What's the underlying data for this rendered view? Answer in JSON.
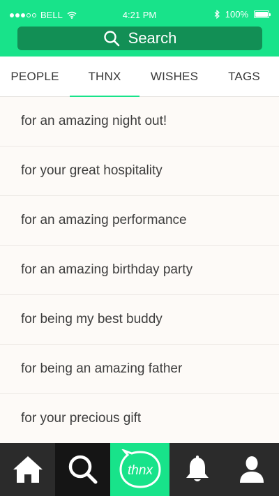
{
  "status_bar": {
    "carrier": "BELL",
    "time": "4:21 PM",
    "battery": "100%",
    "signal_dots_filled": 3,
    "signal_dots_total": 5
  },
  "search": {
    "label": "Search",
    "icon": "search-icon"
  },
  "tabs": [
    {
      "label": "PEOPLE",
      "active": false
    },
    {
      "label": "THNX",
      "active": true
    },
    {
      "label": "WISHES",
      "active": false
    },
    {
      "label": "TAGS",
      "active": false
    }
  ],
  "thnx_list": [
    {
      "text": "for an amazing night out!"
    },
    {
      "text": "for your great hospitality"
    },
    {
      "text": "for an amazing performance"
    },
    {
      "text": "for an amazing birthday party"
    },
    {
      "text": "for being my best buddy"
    },
    {
      "text": "for being an amazing father"
    },
    {
      "text": "for your precious gift"
    }
  ],
  "bottom_nav": [
    {
      "icon": "home-icon"
    },
    {
      "icon": "search-icon"
    },
    {
      "icon": "thnx-logo",
      "brand_text": "thnx"
    },
    {
      "icon": "bell-icon"
    },
    {
      "icon": "profile-icon"
    }
  ],
  "colors": {
    "brand_green": "#18e38a",
    "search_bg": "#128f55",
    "tab_indicator": "#18e38a",
    "nav_bg": "#2b2b2b",
    "nav_active_bg": "#151515"
  }
}
